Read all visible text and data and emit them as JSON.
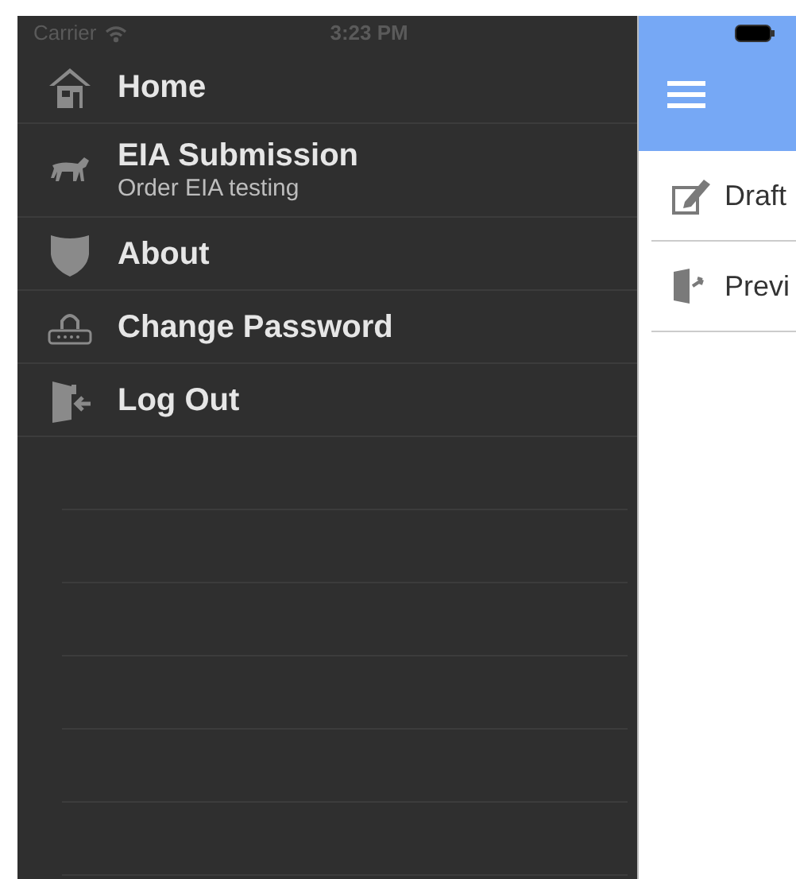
{
  "status_bar": {
    "carrier": "Carrier",
    "time": "3:23 PM"
  },
  "menu": [
    {
      "kind": "home",
      "label": "Home"
    },
    {
      "kind": "horse",
      "label": "EIA Submission",
      "subtitle": "Order EIA testing"
    },
    {
      "kind": "shield",
      "label": "About"
    },
    {
      "kind": "password",
      "label": "Change Password"
    },
    {
      "kind": "logout",
      "label": "Log Out"
    }
  ],
  "content": {
    "items": [
      {
        "kind": "edit",
        "label": "Draft"
      },
      {
        "kind": "exit",
        "label": "Previ"
      }
    ]
  }
}
